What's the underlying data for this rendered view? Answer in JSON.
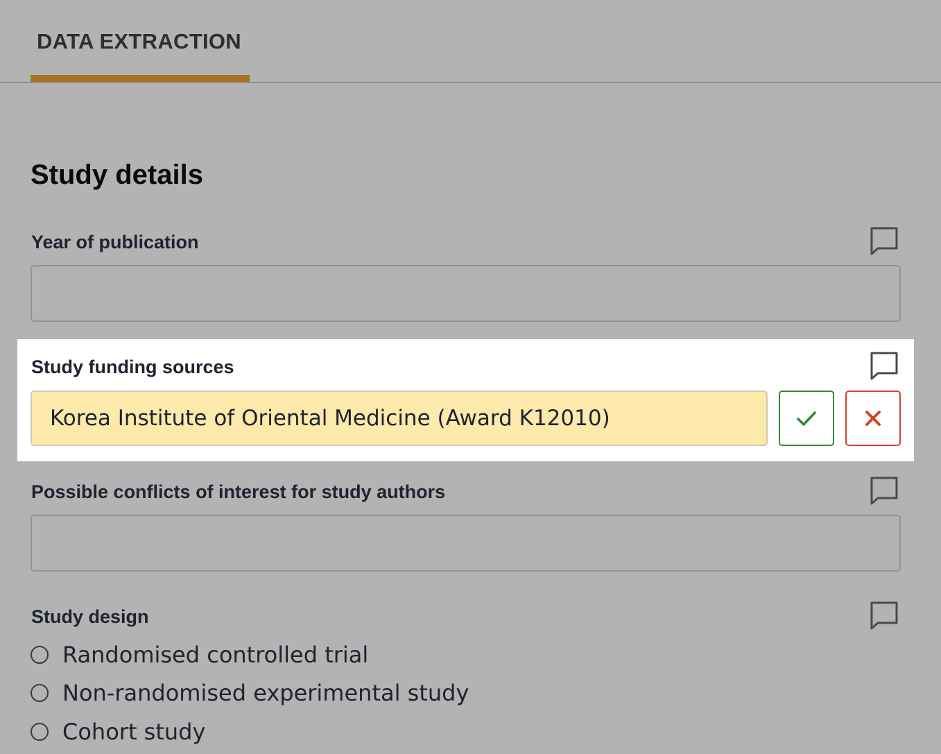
{
  "tabs": [
    {
      "label": "DATA EXTRACTION",
      "active": true
    }
  ],
  "section": {
    "title": "Study details"
  },
  "fields": {
    "year": {
      "label": "Year of publication",
      "value": ""
    },
    "funding": {
      "label": "Study funding sources",
      "value": "Korea Institute of Oriental Medicine (Award K12010)"
    },
    "conflicts": {
      "label": "Possible conflicts of interest for study authors",
      "value": ""
    },
    "design": {
      "label": "Study design",
      "options": [
        "Randomised controlled trial",
        "Non-randomised experimental study",
        "Cohort study"
      ]
    }
  },
  "icons": {
    "comment": "speech-bubble-icon",
    "accept": "check-icon",
    "reject": "x-icon"
  },
  "colors": {
    "tab_accent": "#a87421",
    "highlight_fill": "#fde9aa",
    "accept": "#2f8a3a",
    "reject": "#d1442a"
  }
}
